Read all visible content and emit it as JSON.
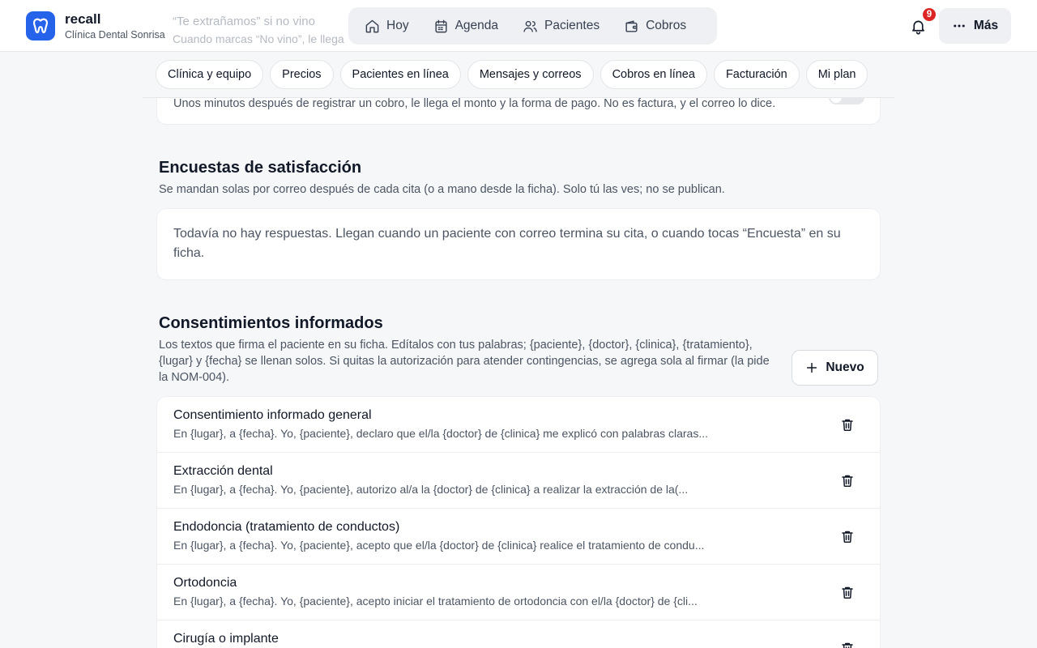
{
  "brand": {
    "name": "recall",
    "subtitle": "Clínica Dental Sonrisa"
  },
  "bleed": {
    "line1": "“Te extrañamos” si no vino",
    "line2": "Cuando marcas “No vino”, le llega"
  },
  "nav": [
    {
      "label": "Hoy",
      "icon": "home-icon"
    },
    {
      "label": "Agenda",
      "icon": "calendar-icon"
    },
    {
      "label": "Pacientes",
      "icon": "users-icon"
    },
    {
      "label": "Cobros",
      "icon": "wallet-icon"
    }
  ],
  "notifications": {
    "count": "9"
  },
  "more": {
    "label": "Más"
  },
  "subtabs": [
    "Clínica y equipo",
    "Precios",
    "Pacientes en línea",
    "Mensajes y correos",
    "Cobros en línea",
    "Facturación",
    "Mi plan"
  ],
  "receipt_card": {
    "text": "Unos minutos después de registrar un cobro, le llega el monto y la forma de pago. No es factura, y el correo lo dice."
  },
  "surveys": {
    "title": "Encuestas de satisfacción",
    "description": "Se mandan solas por correo después de cada cita (o a mano desde la ficha). Solo tú las ves; no se publican.",
    "empty": "Todavía no hay respuestas. Llegan cuando un paciente con correo termina su cita, o cuando tocas “Encuesta” en su ficha."
  },
  "consents": {
    "title": "Consentimientos informados",
    "description": "Los textos que firma el paciente en su ficha. Edítalos con tus palabras; {paciente}, {doctor}, {clinica}, {tratamiento}, {lugar} y {fecha} se llenan solos. Si quitas la autorización para atender contingencias, se agrega sola al firmar (la pide la NOM-004).",
    "new_label": "Nuevo",
    "items": [
      {
        "title": "Consentimiento informado general",
        "snippet": "En {lugar}, a {fecha}. Yo, {paciente}, declaro que el/la {doctor} de {clinica} me explicó con palabras claras..."
      },
      {
        "title": "Extracción dental",
        "snippet": "En {lugar}, a {fecha}. Yo, {paciente}, autorizo al/a la {doctor} de {clinica} a realizar la extracción de la(..."
      },
      {
        "title": "Endodoncia (tratamiento de conductos)",
        "snippet": "En {lugar}, a {fecha}. Yo, {paciente}, acepto que el/la {doctor} de {clinica} realice el tratamiento de condu..."
      },
      {
        "title": "Ortodoncia",
        "snippet": "En {lugar}, a {fecha}. Yo, {paciente}, acepto iniciar el tratamiento de ortodoncia con el/la {doctor} de {cli..."
      },
      {
        "title": "Cirugía o implante",
        "snippet": ""
      }
    ]
  }
}
